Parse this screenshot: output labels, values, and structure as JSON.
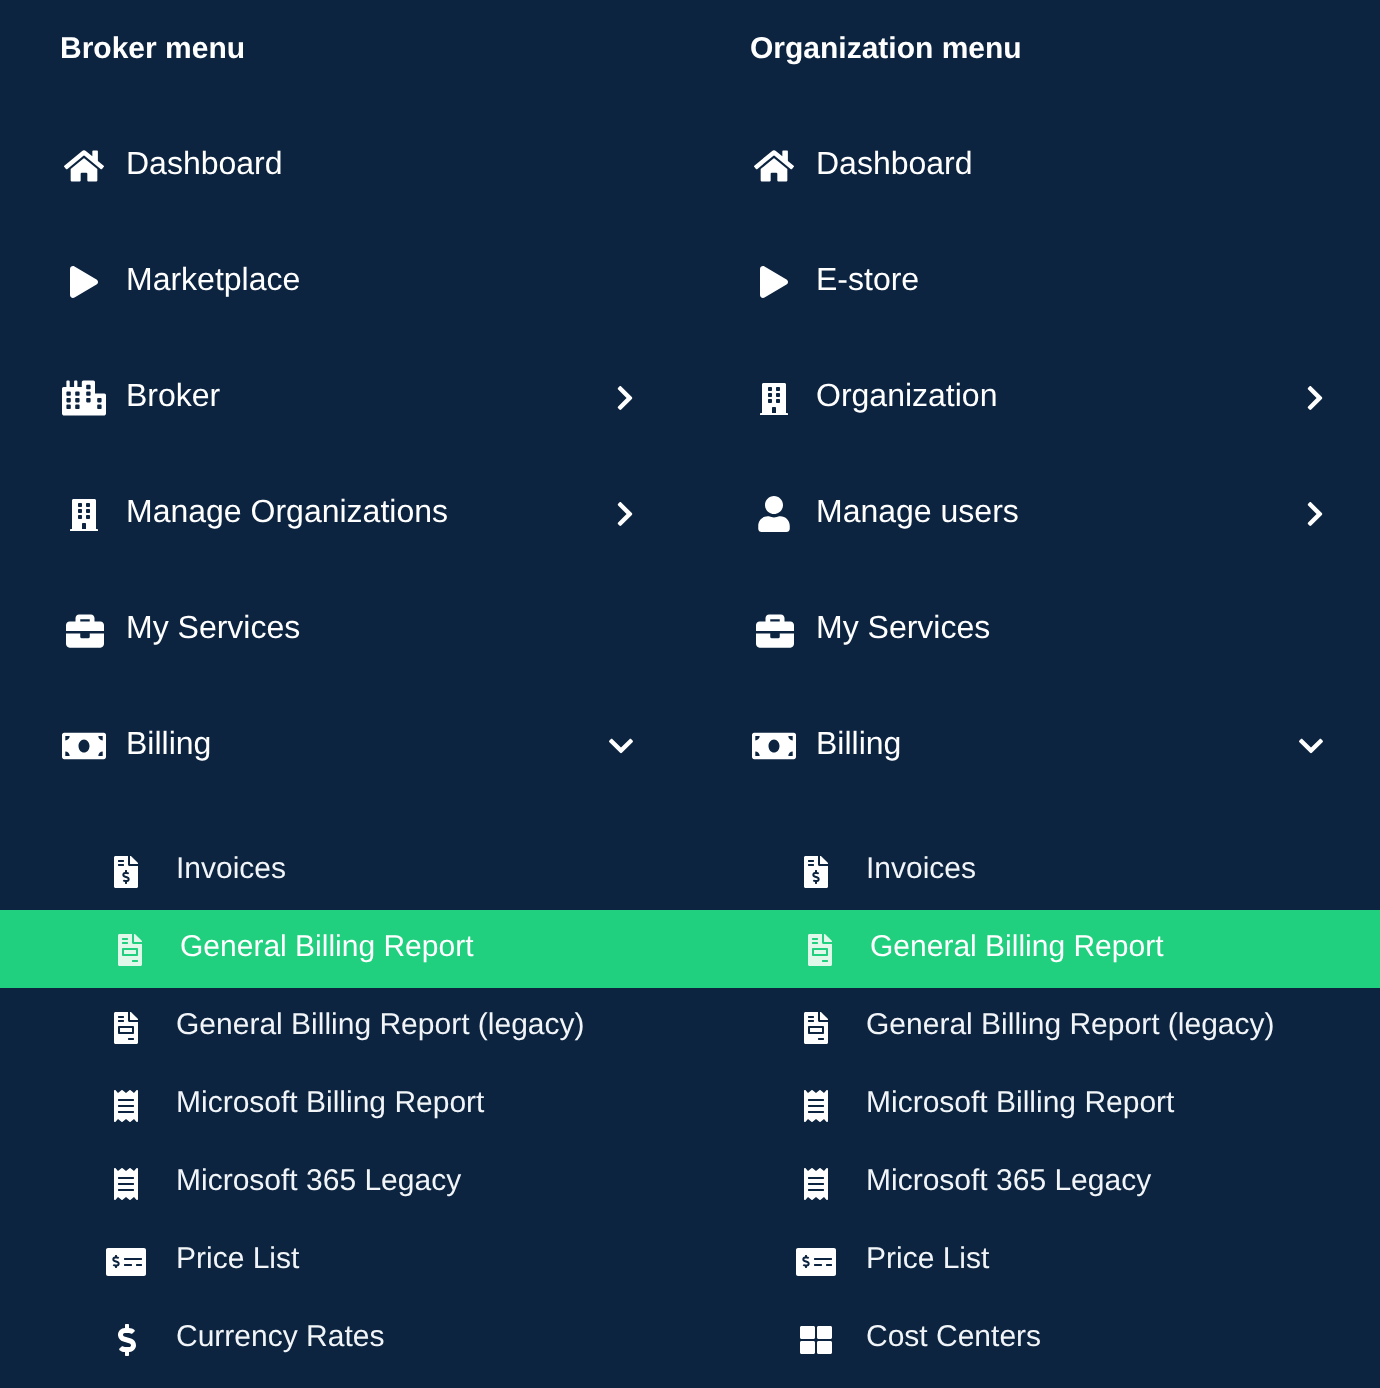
{
  "menus": [
    {
      "title": "Broker menu",
      "items": [
        {
          "label": "Dashboard"
        },
        {
          "label": "Marketplace"
        },
        {
          "label": "Broker",
          "expanded": false
        },
        {
          "label": "Manage Organizations",
          "expanded": false
        },
        {
          "label": "My Services"
        },
        {
          "label": "Billing",
          "expanded": true,
          "children": [
            {
              "label": "Invoices",
              "selected": false
            },
            {
              "label": "General Billing Report",
              "selected": true
            },
            {
              "label": "General Billing Report (legacy)",
              "selected": false
            },
            {
              "label": "Microsoft Billing Report",
              "selected": false
            },
            {
              "label": "Microsoft 365 Legacy",
              "selected": false
            },
            {
              "label": "Price List",
              "selected": false
            },
            {
              "label": "Currency Rates",
              "selected": false
            }
          ]
        }
      ]
    },
    {
      "title": "Organization menu",
      "items": [
        {
          "label": "Dashboard"
        },
        {
          "label": "E-store"
        },
        {
          "label": "Organization",
          "expanded": false
        },
        {
          "label": "Manage users",
          "expanded": false
        },
        {
          "label": "My Services"
        },
        {
          "label": "Billing",
          "expanded": true,
          "children": [
            {
              "label": "Invoices",
              "selected": false
            },
            {
              "label": "General Billing Report",
              "selected": true
            },
            {
              "label": "General Billing Report (legacy)",
              "selected": false
            },
            {
              "label": "Microsoft Billing Report",
              "selected": false
            },
            {
              "label": "Microsoft 365 Legacy",
              "selected": false
            },
            {
              "label": "Price List",
              "selected": false
            },
            {
              "label": "Cost Centers",
              "selected": false
            }
          ]
        }
      ]
    }
  ]
}
